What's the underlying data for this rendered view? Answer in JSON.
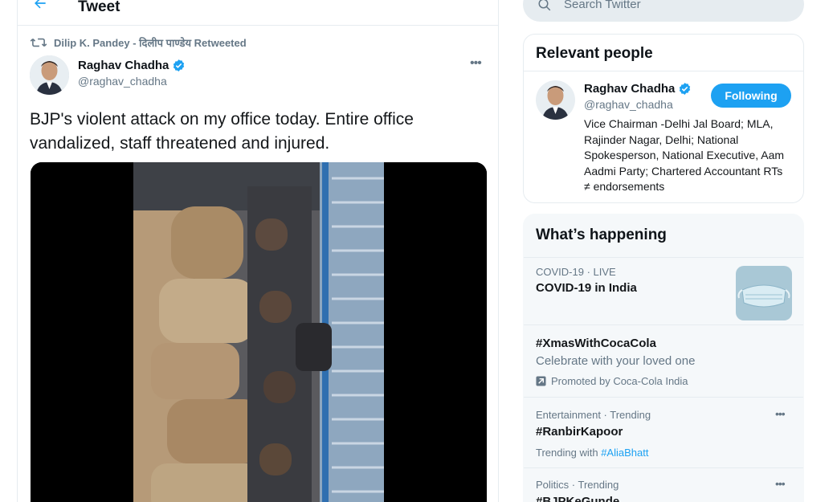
{
  "header": {
    "title": "Tweet",
    "back_icon": "back-arrow-icon"
  },
  "tweet": {
    "retweeted_by": "Dilip K. Pandey - दिलीप पाण्डेय Retweeted",
    "author_name": "Raghav Chadha",
    "author_handle": "@raghav_chadha",
    "more_label": "•••",
    "text": "BJP's violent attack on my office today. Entire office vandalized, staff threatened and injured."
  },
  "search": {
    "placeholder": "Search Twitter"
  },
  "relevant_people": {
    "title": "Relevant people",
    "person": {
      "name": "Raghav Chadha",
      "handle": "@raghav_chadha",
      "follow_label": "Following",
      "bio": "Vice Chairman -Delhi Jal Board; MLA, Rajinder Nagar, Delhi; National Spokesperson, National Executive, Aam Aadmi Party; Chartered Accountant RTs ≠ endorsements"
    }
  },
  "whats_happening": {
    "title": "What’s happening",
    "trends": [
      {
        "meta": "COVID-19 · LIVE",
        "title": "COVID-19 in India"
      },
      {
        "title": "#XmasWithCocaCola",
        "subtitle": "Celebrate with your loved one",
        "promoted": "Promoted by Coca-Cola India"
      },
      {
        "meta": "Entertainment · Trending",
        "title": "#RanbirKapoor",
        "with_prefix": "Trending with",
        "with_tag": "#AliaBhatt",
        "more": "•••"
      },
      {
        "meta": "Politics · Trending",
        "title": "#BJPKeGunde",
        "more": "•••"
      }
    ]
  },
  "colors": {
    "accent": "#1da1f2",
    "secondary_text": "#657786",
    "border": "#e6ecf0"
  }
}
